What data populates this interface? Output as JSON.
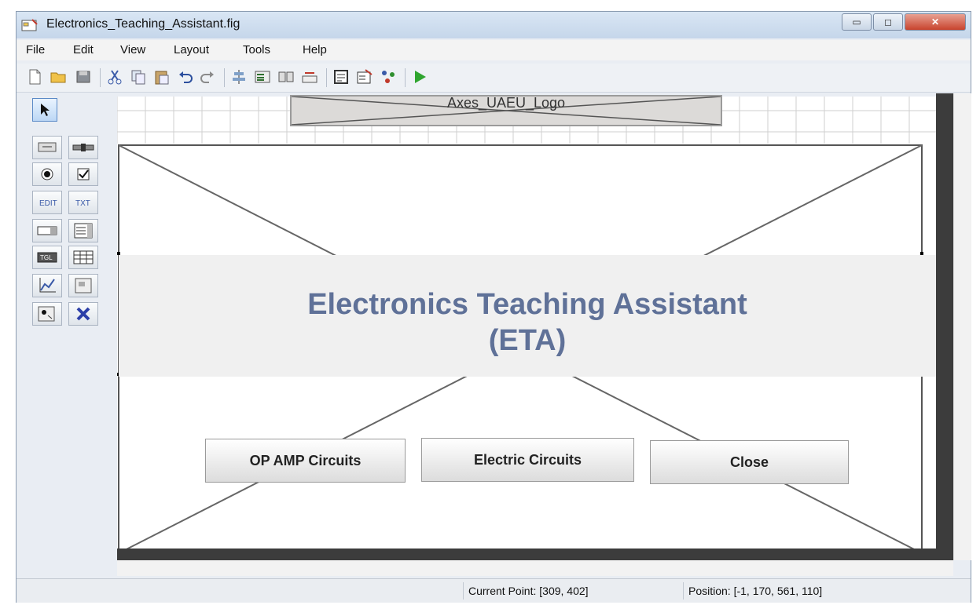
{
  "window": {
    "title": "Electronics_Teaching_Assistant.fig",
    "controls": {
      "minimize": "▭",
      "maximize": "◻",
      "close": "✕"
    }
  },
  "menu": {
    "items": [
      "File",
      "Edit",
      "View",
      "Layout",
      "Tools",
      "Help"
    ]
  },
  "toolbar": {
    "icons": [
      "new-file-icon",
      "open-folder-icon",
      "save-icon",
      "cut-icon",
      "copy-icon",
      "paste-icon",
      "undo-icon",
      "redo-icon",
      "align-objects-icon",
      "menu-editor-icon",
      "tab-order-icon",
      "toolbar-editor-icon",
      "m-file-editor-icon",
      "property-inspector-icon",
      "object-browser-icon",
      "run-figure-icon"
    ]
  },
  "palette": {
    "icons": [
      "select-arrow-icon",
      "push-button-icon",
      "slider-icon",
      "radio-button-icon",
      "checkbox-icon",
      "edit-text-icon",
      "static-text-icon",
      "popup-menu-icon",
      "listbox-icon",
      "toggle-button-icon",
      "table-icon",
      "axes-icon",
      "panel-icon",
      "button-group-icon",
      "activex-control-icon"
    ]
  },
  "canvas": {
    "logo_axes_label": "Axes_UAEU_Logo",
    "title_line1": "Electronics Teaching Assistant",
    "title_line2": "(ETA)",
    "buttons": {
      "op_amp": "OP AMP Circuits",
      "electric": "Electric Circuits",
      "close": "Close"
    }
  },
  "status": {
    "current_point": "Current Point:  [309, 402]",
    "position": "Position: [-1, 170, 561, 110]"
  },
  "colors": {
    "title_text": "#5f7198",
    "run_green": "#2fa52f",
    "frame_dark": "#3c3c3c"
  }
}
